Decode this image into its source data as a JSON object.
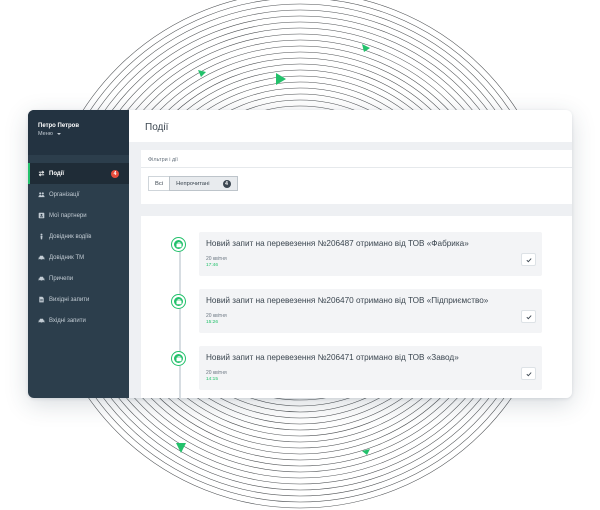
{
  "sidebar": {
    "user_name": "Петро Петров",
    "menu_label": "Меню",
    "items": [
      {
        "label": "Події",
        "icon": "exchange-icon",
        "active": true,
        "badge": "4"
      },
      {
        "label": "Організації",
        "icon": "users-icon"
      },
      {
        "label": "Мої партнери",
        "icon": "contact-card-icon"
      },
      {
        "label": "Довідник водіїв",
        "icon": "driver-icon"
      },
      {
        "label": "Довідник ТМ",
        "icon": "car-icon"
      },
      {
        "label": "Причепи",
        "icon": "car-icon"
      },
      {
        "label": "Вихідні запити",
        "icon": "document-icon"
      },
      {
        "label": "Вхідні запити",
        "icon": "car-icon"
      }
    ]
  },
  "header": {
    "title": "Події"
  },
  "filters": {
    "title": "Фільтри і дії",
    "all_label": "Всі",
    "unread_label": "Непрочитані",
    "unread_count": "4"
  },
  "events": [
    {
      "title": "Новий запит на перевезення №206487 отримано від ТОВ «Фабрика»",
      "date": "20 квітня",
      "time": "17:46"
    },
    {
      "title": "Новий запит на перевезення №206470 отримано від ТОВ «Підприємство»",
      "date": "20 квітня",
      "time": "15:26"
    },
    {
      "title": "Новий запит на перевезення №206471 отримано від ТОВ «Завод»",
      "date": "20 квітня",
      "time": "14:15"
    }
  ],
  "colors": {
    "accent": "#23c16b",
    "sidebar": "#2c3e4c",
    "badge": "#e74c3c"
  }
}
